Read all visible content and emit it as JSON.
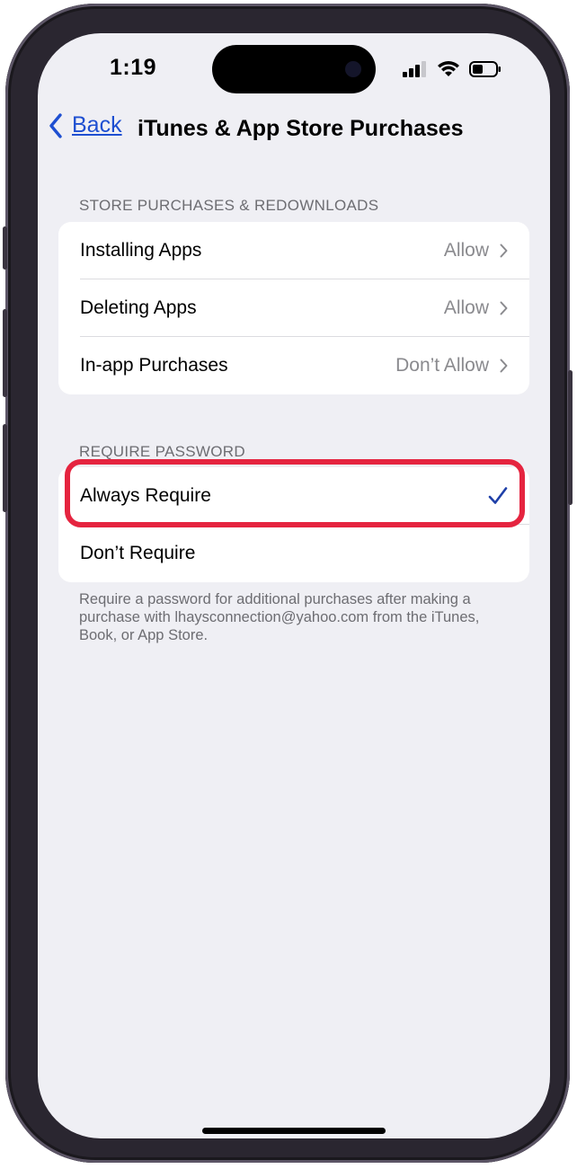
{
  "status_bar": {
    "time": "1:19"
  },
  "nav": {
    "back_label": "Back",
    "title": "iTunes & App Store Purchases"
  },
  "store_section": {
    "header": "STORE PURCHASES & REDOWNLOADS",
    "rows": [
      {
        "label": "Installing Apps",
        "value": "Allow"
      },
      {
        "label": "Deleting Apps",
        "value": "Allow"
      },
      {
        "label": "In-app Purchases",
        "value": "Don’t Allow"
      }
    ]
  },
  "password_section": {
    "header": "REQUIRE PASSWORD",
    "options": [
      {
        "label": "Always Require",
        "selected": true
      },
      {
        "label": "Don’t Require",
        "selected": false
      }
    ],
    "footer": "Require a password for additional purchases after making a purchase with lhaysconnection@yahoo.com from the iTunes, Book, or App Store."
  },
  "colors": {
    "accent": "#1e4fd1",
    "highlight": "#e5243f",
    "background": "#efeff4"
  }
}
